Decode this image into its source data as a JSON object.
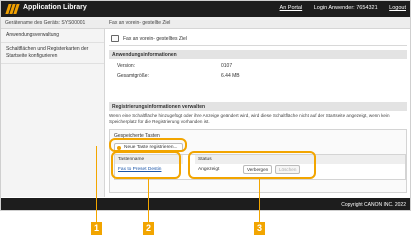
{
  "header": {
    "app_title": "Application Library",
    "portal_link": "An Portal",
    "login_label": "Login Anwender:",
    "login_user": "7654321",
    "logout_link": "Logout"
  },
  "subheader": {
    "device_name": "Gerätename des Geräts: SYS00001",
    "page_title": "Fax an vorein- gestellte Ziel"
  },
  "sidebar": {
    "items": [
      {
        "label": "Anwendungsverwaltung"
      },
      {
        "label": "Schaltflächen und Registerkarten der Startseite konfigurieren"
      }
    ]
  },
  "main": {
    "fax_button_label": "Fax an vorein- gestelltes Ziel",
    "app_info": {
      "title": "Anwendungsinformationen",
      "version_label": "Version:",
      "version_value": "0107",
      "size_label": "Gesamtgröße:",
      "size_value": "6.44 MB"
    },
    "register": {
      "title": "Registrierungsinformationen verwalten",
      "note": "Wenn eine Schaltfläche hinzugefügt oder ihre Anzeige geändert wird, wird diese Schaltfläche nicht auf der Startseite angezeigt, wenn kein Speicherplatz für die Registrierung vorhanden ist.",
      "saved_title": "Gespeicherte Tasten",
      "new_button": "Neue Taste registrieren...",
      "col_name": "Tastenname",
      "col_status": "Status",
      "row_name": "Fax to Preset Destin",
      "row_status": "Angezeigt",
      "hide_button": "Verbergen",
      "delete_button": "Löschen"
    }
  },
  "footer": {
    "copyright": "Copyright CANON INC. 2022"
  },
  "callouts": [
    "1",
    "2",
    "3"
  ],
  "colors": {
    "header_bg": "#1d1d1d",
    "callout": "#f2a500",
    "link": "#1a55a8"
  }
}
